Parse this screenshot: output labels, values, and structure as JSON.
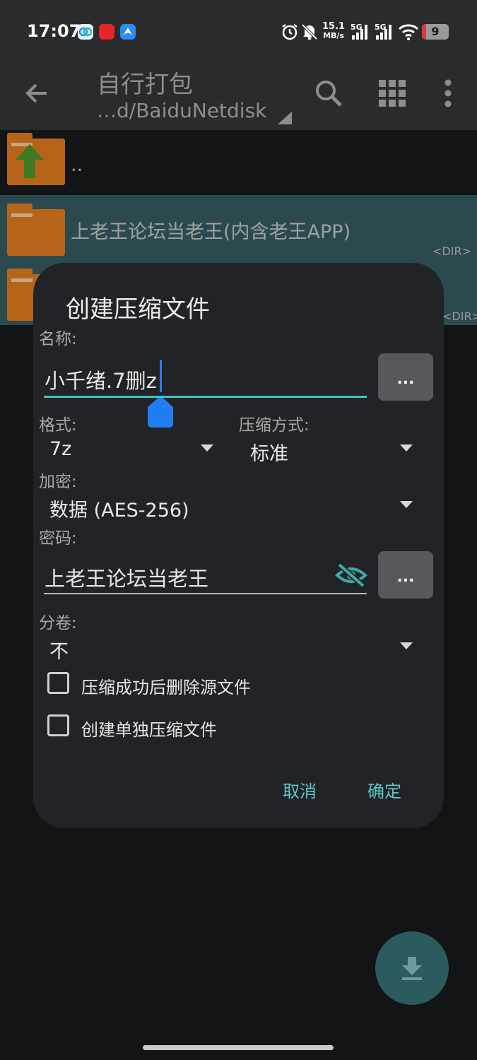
{
  "status_bar": {
    "time": "17:07",
    "net_speed_value": "15.1",
    "net_speed_unit": "MB/s",
    "signal1_label": "5G",
    "signal2_label": "5G",
    "battery_level": "9",
    "icons": [
      "baidu-netdisk-app-icon",
      "red-app-icon",
      "blue-app-icon",
      "alarm-icon",
      "mute-icon",
      "signal-icon",
      "signal-icon",
      "wifi-icon",
      "battery-icon"
    ]
  },
  "toolbar": {
    "title": "自行打包",
    "path": "…d/BaiduNetdisk",
    "icons": [
      "back-arrow-icon",
      "search-icon",
      "grid-icon",
      "more-vert-icon"
    ]
  },
  "file_list": {
    "items": [
      {
        "name": "..",
        "tag": ""
      },
      {
        "name": "上老王论坛当老王(内含老王APP)",
        "tag": "<DIR>"
      },
      {
        "name": "",
        "tag": "<DIR>"
      }
    ]
  },
  "dialog": {
    "title": "创建压缩文件",
    "name_label": "名称:",
    "name_value": "小千绪.7删z",
    "format_label": "格式:",
    "format_value": "7z",
    "method_label": "压缩方式:",
    "method_value": "标准",
    "encryption_label": "加密:",
    "encryption_value": "数据 (AES-256)",
    "password_label": "密码:",
    "password_value": "上老王论坛当老王",
    "split_label": "分卷:",
    "split_value": "不",
    "more_button": "...",
    "checkbox_delete_source": {
      "label": "压缩成功后删除源文件",
      "checked": false
    },
    "checkbox_separate": {
      "label": "创建单独压缩文件",
      "checked": false
    },
    "cancel_label": "取消",
    "confirm_label": "确定",
    "accent_color": "#5ec6c6"
  },
  "fab_icon": "download-icon"
}
